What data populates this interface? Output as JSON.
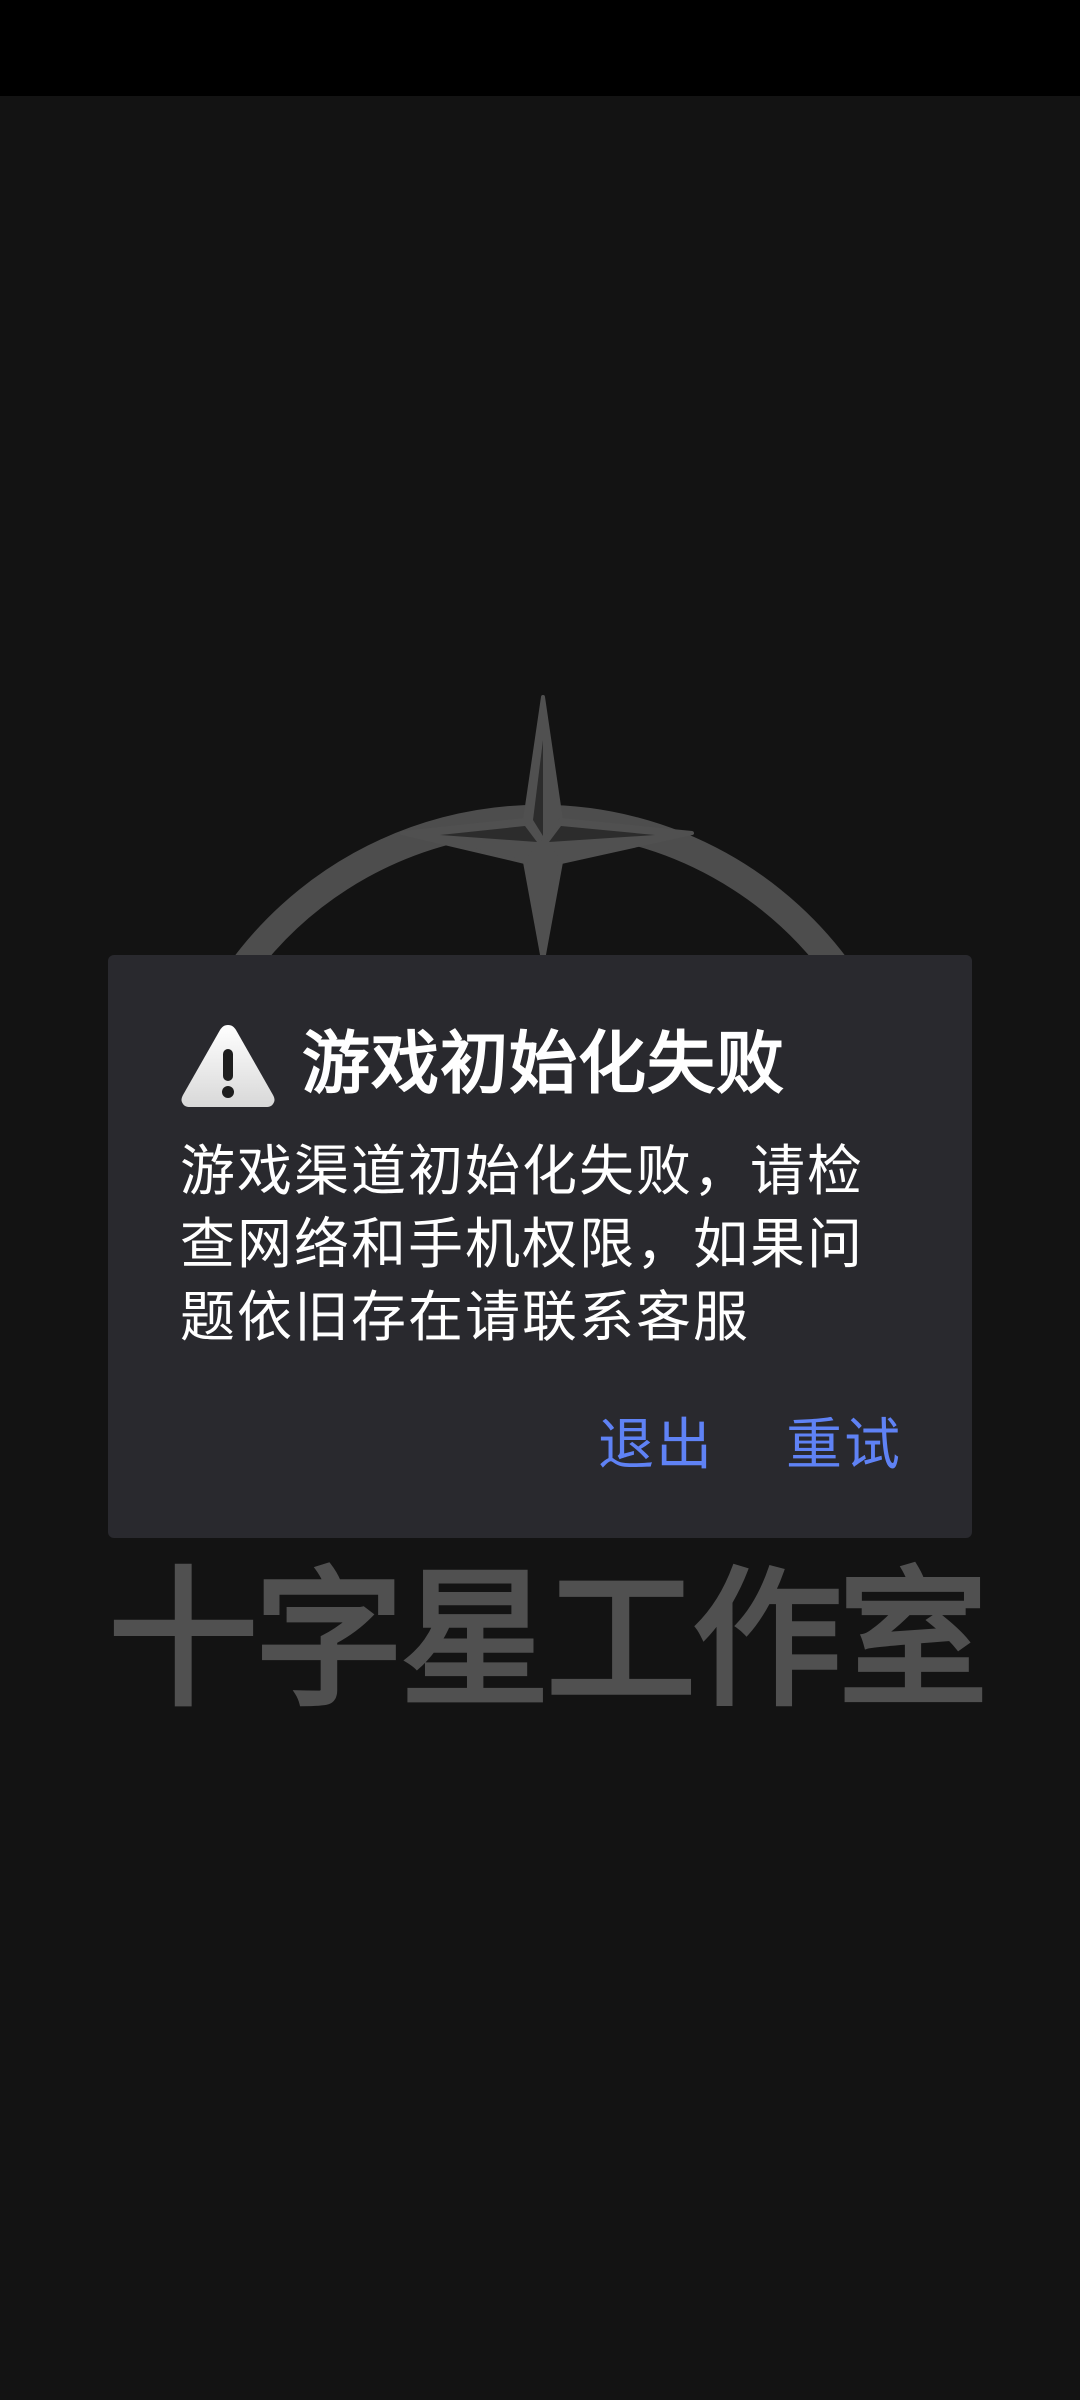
{
  "colors": {
    "status_bar": "#000000",
    "background": "#131313",
    "logo": "#505050",
    "dialog_bg": "#29292e",
    "text": "#ffffff",
    "accent": "#5f82f5"
  },
  "splash": {
    "logo_icon": "compass-star-icon",
    "studio_name_chars": [
      "十",
      "字",
      "星",
      "工",
      "作",
      "室"
    ]
  },
  "dialog": {
    "icon": "warning-icon",
    "title": "游戏初始化失败",
    "message": "游戏渠道初始化失败，请检查网络和手机权限，如果问题依旧存在请联系客服",
    "buttons": {
      "exit": "退出",
      "retry": "重试"
    }
  }
}
